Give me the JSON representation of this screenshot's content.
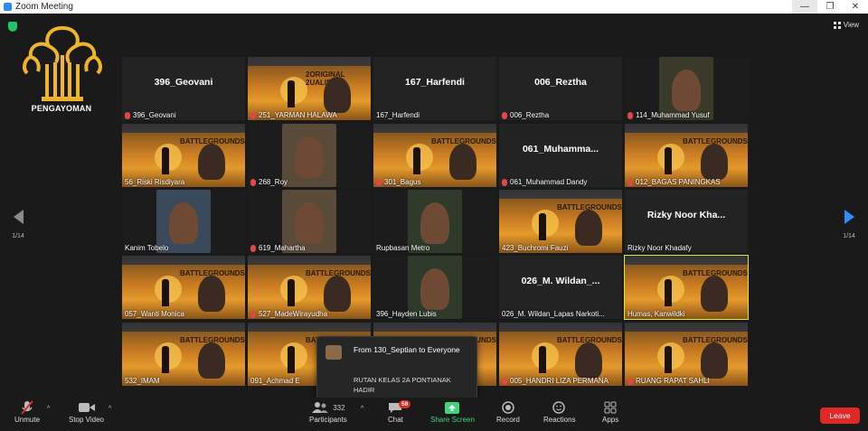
{
  "window": {
    "title": "Zoom Meeting",
    "controls": [
      "—",
      "❐",
      "✕"
    ]
  },
  "top": {
    "view_label": "View"
  },
  "logo": {
    "text": "PENGAYOMAN",
    "color": "#f0b429"
  },
  "pager": {
    "left": "1/14",
    "right": "1/14"
  },
  "tiles": [
    {
      "label": "396_Geovani",
      "big": "396_Geovani",
      "muted": true
    },
    {
      "label": "251_YARMAN HALAWA",
      "muted": true,
      "poster": "2ORIGINAL 2UALIBLE"
    },
    {
      "label": "167_Harfendi",
      "big": "167_Harfendi",
      "muted": false
    },
    {
      "label": "006_Reztha",
      "big": "006_Reztha",
      "muted": true
    },
    {
      "label": "114_Muhammad Yusuf",
      "muted": true
    },
    {
      "label": "56_Riski Risdiyara",
      "muted": false,
      "poster": "BATTLEGROUNDS"
    },
    {
      "label": "268_Roy",
      "muted": true
    },
    {
      "label": "301_Bagus",
      "muted": true,
      "poster": "BATTLEGROUNDS"
    },
    {
      "label": "061_Muhammad Dandy",
      "big": "061_Muhamma...",
      "muted": true
    },
    {
      "label": "012_BAGAS PANINGKAS",
      "muted": true,
      "poster": "BATTLEGROUNDS"
    },
    {
      "label": "Kanim Tobelo",
      "muted": false
    },
    {
      "label": "619_Mahartha",
      "muted": true
    },
    {
      "label": "Rupbasan Metro",
      "muted": false
    },
    {
      "label": "423_Buchromi Fauzi",
      "muted": false,
      "poster": "BATTLEGROUNDS"
    },
    {
      "label": "Rizky Noor Khadafy",
      "big": "Rizky Noor Kha...",
      "muted": false
    },
    {
      "label": "057_Wanti Monica",
      "muted": false,
      "poster": "BATTLEGROUNDS"
    },
    {
      "label": "527_MadeWirayudha",
      "muted": true,
      "poster": "BATTLEGROUNDS"
    },
    {
      "label": "396_Hayden Lubis",
      "muted": false
    },
    {
      "label": "026_M. Wildan_Lapas Narkoti...",
      "big": "026_M. Wildan_...",
      "muted": false
    },
    {
      "label": "Humas, Kanwildki",
      "muted": false,
      "poster": "BATTLEGROUNDS",
      "active": true
    },
    {
      "label": "532_IMAM",
      "muted": false,
      "poster": "BATTLEGROUNDS"
    },
    {
      "label": "091_Achmad E",
      "muted": false,
      "poster": "BATTLEGROUNDS"
    },
    {
      "label": "",
      "muted": false,
      "poster": "BATTLEGROUNDS"
    },
    {
      "label": "005_HANDRI LIZA PERMANA",
      "muted": true,
      "poster": "BATTLEGROUNDS"
    },
    {
      "label": "RUANG RAPAT SAHLI",
      "muted": true,
      "poster": "BATTLEGROUNDS"
    }
  ],
  "chat_popup": {
    "from": "From 130_Septian to Everyone",
    "message": "RUTAN KELAS 2A PONTIANAK HADIR"
  },
  "toolbar": {
    "unmute": "Unmute",
    "stop_video": "Stop Video",
    "participants": "Participants",
    "participants_count": "332",
    "chat": "Chat",
    "chat_badge": "58",
    "share_screen": "Share Screen",
    "record": "Record",
    "reactions": "Reactions",
    "apps": "Apps",
    "leave": "Leave"
  },
  "colors": {
    "accent": "#2d8cff",
    "leave": "#e02828",
    "share": "#3fd37a",
    "active_speaker": "#dfe24a"
  }
}
